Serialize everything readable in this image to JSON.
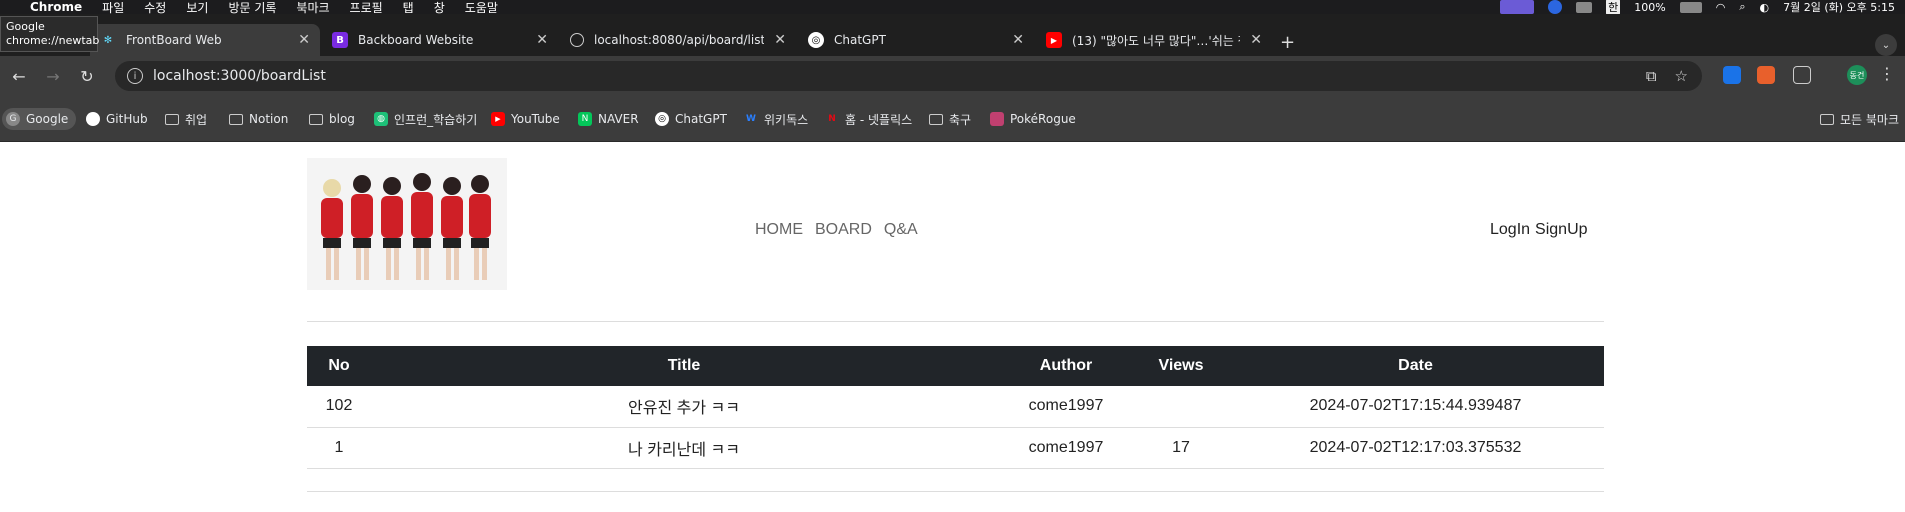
{
  "menubar": {
    "items": [
      "Chrome",
      "파일",
      "수정",
      "보기",
      "방문 기록",
      "북마크",
      "프로필",
      "탭",
      "창",
      "도움말"
    ],
    "battery": "100%",
    "clock": "7월 2일 (화) 오후 5:15",
    "input_lang": "한"
  },
  "tooltip": {
    "line1": "Google",
    "line2": "chrome://newtab"
  },
  "tabs": [
    {
      "title": "FrontBoard Web",
      "active": true
    },
    {
      "title": "Backboard Website",
      "favicon_letter": "B"
    },
    {
      "title": "localhost:8080/api/board/list/"
    },
    {
      "title": "ChatGPT"
    },
    {
      "title": "(13) \"많아도 너무 많다\"…'쉬는 청"
    }
  ],
  "address": {
    "url": "localhost:3000/boardList"
  },
  "bookmarks": [
    {
      "label": "Google",
      "icon": "google-icon"
    },
    {
      "label": "GitHub",
      "icon": "github-icon"
    },
    {
      "label": "취업",
      "icon": "folder-icon"
    },
    {
      "label": "Notion",
      "icon": "folder-icon"
    },
    {
      "label": "blog",
      "icon": "folder-icon"
    },
    {
      "label": "인프런_학습하기",
      "icon": "inflearn-icon"
    },
    {
      "label": "YouTube",
      "icon": "youtube-icon"
    },
    {
      "label": "NAVER",
      "icon": "naver-icon"
    },
    {
      "label": "ChatGPT",
      "icon": "chatgpt-icon"
    },
    {
      "label": "위키독스",
      "icon": "wikidocs-icon"
    },
    {
      "label": "홈 - 넷플릭스",
      "icon": "netflix-icon"
    },
    {
      "label": "축구",
      "icon": "folder-icon"
    },
    {
      "label": "PokéRogue",
      "icon": "pokerogue-icon"
    }
  ],
  "all_bookmarks": "모든 북마크",
  "profile_initials": "동건",
  "site": {
    "nav": [
      "HOME",
      "BOARD",
      "Q&A"
    ],
    "login": "LogIn",
    "signup": "SignUp"
  },
  "table": {
    "headers": [
      "No",
      "Title",
      "Author",
      "Views",
      "Date"
    ],
    "rows": [
      [
        "102",
        "안유진 추가 ㅋㅋ",
        "come1997",
        "",
        "2024-07-02T17:15:44.939487"
      ],
      [
        "1",
        "나 카리난데 ㅋㅋ",
        "come1997",
        "17",
        "2024-07-02T12:17:03.375532"
      ]
    ]
  },
  "colors": {
    "table_header": "#212529",
    "tab_bg": "#1f1f1f",
    "toolbar_bg": "#3c3c3c"
  }
}
